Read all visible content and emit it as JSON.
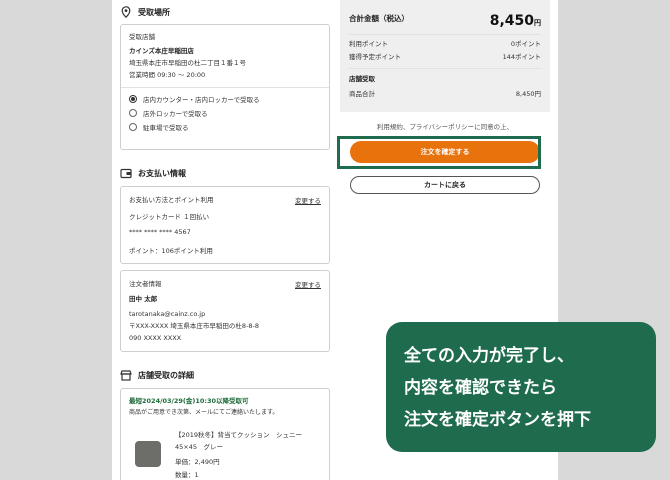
{
  "pickup": {
    "title": "受取場所",
    "store_label": "受取店舗",
    "store_name": "カインズ本庄早稲田店",
    "store_address": "埼玉県本庄市早稲田の杜二丁目１番１号",
    "store_hours": "営業時間 09:30 ～ 20:00",
    "options": [
      {
        "label": "店内カウンター・店内ロッカーで受取る",
        "selected": true
      },
      {
        "label": "店外ロッカーで受取る",
        "selected": false
      },
      {
        "label": "駐車場で受取る",
        "selected": false
      }
    ]
  },
  "payment": {
    "title": "お支払い情報",
    "method_heading": "お支払い方法とポイント利用",
    "change_label": "変更する",
    "method": "クレジットカード １回払い",
    "card_number": "**** **** **** 4567",
    "points": "ポイント：106ポイント利用"
  },
  "orderer": {
    "heading": "注文者情報",
    "change_label": "変更する",
    "name": "田中 太郎",
    "email": "tarotanaka@cainz.co.jp",
    "address": "〒XXX-XXXX 埼玉県本庄市早稲田の杜8-8-8",
    "phone": "090 XXXX XXXX"
  },
  "store_pickup_detail": {
    "title": "店舗受取の詳細",
    "earliest": "最短2024/03/29(金)10:30以降受取可",
    "notice": "商品がご用意でき次第、メールにてご連絡いたします。",
    "item_name_1": "【2019秋冬】背当てクッション　シュニー",
    "item_name_2": "45×45　グレー",
    "unit_price": "単価：2,490円",
    "quantity": "数量：1"
  },
  "summary": {
    "total_label": "合計金額（税込）",
    "total_value": "8,450",
    "total_unit": "円",
    "used_points_label": "利用ポイント",
    "used_points_value": "0ポイント",
    "earned_points_label": "獲得予定ポイント",
    "earned_points_value": "144ポイント",
    "pickup_heading": "店舗受取",
    "subtotal_label": "商品合計",
    "subtotal_value": "8,450円"
  },
  "agreement_text": "利用規約、プライバシーポリシーに同意の上、",
  "confirm_button": "注文を確定する",
  "back_button": "カートに戻る",
  "callout": {
    "line1": "全ての入力が完了し、",
    "line2": "内容を確認できたら",
    "line3": "注文を確定ボタンを押下"
  },
  "colors": {
    "accent_orange": "#e8720c",
    "brand_green": "#1e6b4d"
  },
  "icons": [
    "location-pin-icon",
    "wallet-icon",
    "store-icon"
  ]
}
